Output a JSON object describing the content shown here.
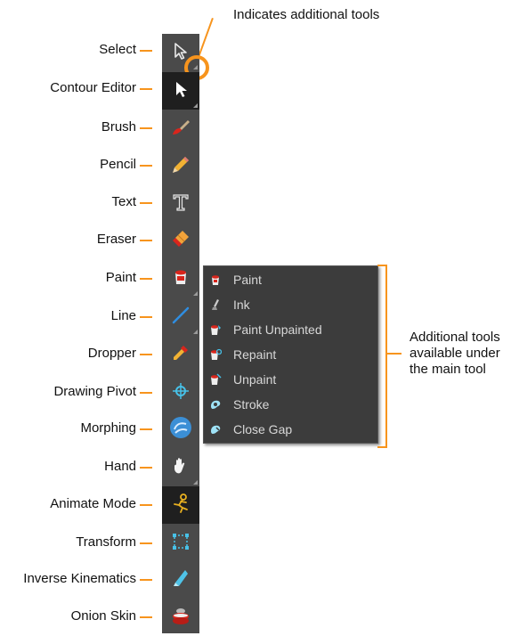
{
  "callout_top": "Indicates additional tools",
  "callout_right": [
    "Additional tools",
    "available under",
    "the main tool"
  ],
  "tools": [
    {
      "label": "Select",
      "icon": "arrow-outline-icon"
    },
    {
      "label": "Contour Editor",
      "icon": "arrow-filled-icon"
    },
    {
      "label": "Brush",
      "icon": "brush-icon"
    },
    {
      "label": "Pencil",
      "icon": "pencil-icon"
    },
    {
      "label": "Text",
      "icon": "text-icon"
    },
    {
      "label": "Eraser",
      "icon": "eraser-icon"
    },
    {
      "label": "Paint",
      "icon": "paint-bucket-icon"
    },
    {
      "label": "Line",
      "icon": "line-icon"
    },
    {
      "label": "Dropper",
      "icon": "dropper-icon"
    },
    {
      "label": "Drawing Pivot",
      "icon": "pivot-icon"
    },
    {
      "label": "Morphing",
      "icon": "morphing-icon"
    },
    {
      "label": "Hand",
      "icon": "hand-icon"
    },
    {
      "label": "Animate Mode",
      "icon": "animate-icon"
    },
    {
      "label": "Transform",
      "icon": "transform-icon"
    },
    {
      "label": "Inverse Kinematics",
      "icon": "ik-icon"
    },
    {
      "label": "Onion  Skin",
      "icon": "onion-skin-icon"
    }
  ],
  "submenu": [
    {
      "label": "Paint",
      "icon": "paint-bucket-icon"
    },
    {
      "label": "Ink",
      "icon": "ink-icon"
    },
    {
      "label": "Paint Unpainted",
      "icon": "paint-unpainted-icon"
    },
    {
      "label": "Repaint",
      "icon": "repaint-icon"
    },
    {
      "label": "Unpaint",
      "icon": "unpaint-icon"
    },
    {
      "label": "Stroke",
      "icon": "stroke-icon"
    },
    {
      "label": "Close Gap",
      "icon": "close-gap-icon"
    }
  ],
  "colors": {
    "accent": "#f7941d",
    "toolbar": "#4a4a4a",
    "submenu": "#3c3c3c"
  }
}
